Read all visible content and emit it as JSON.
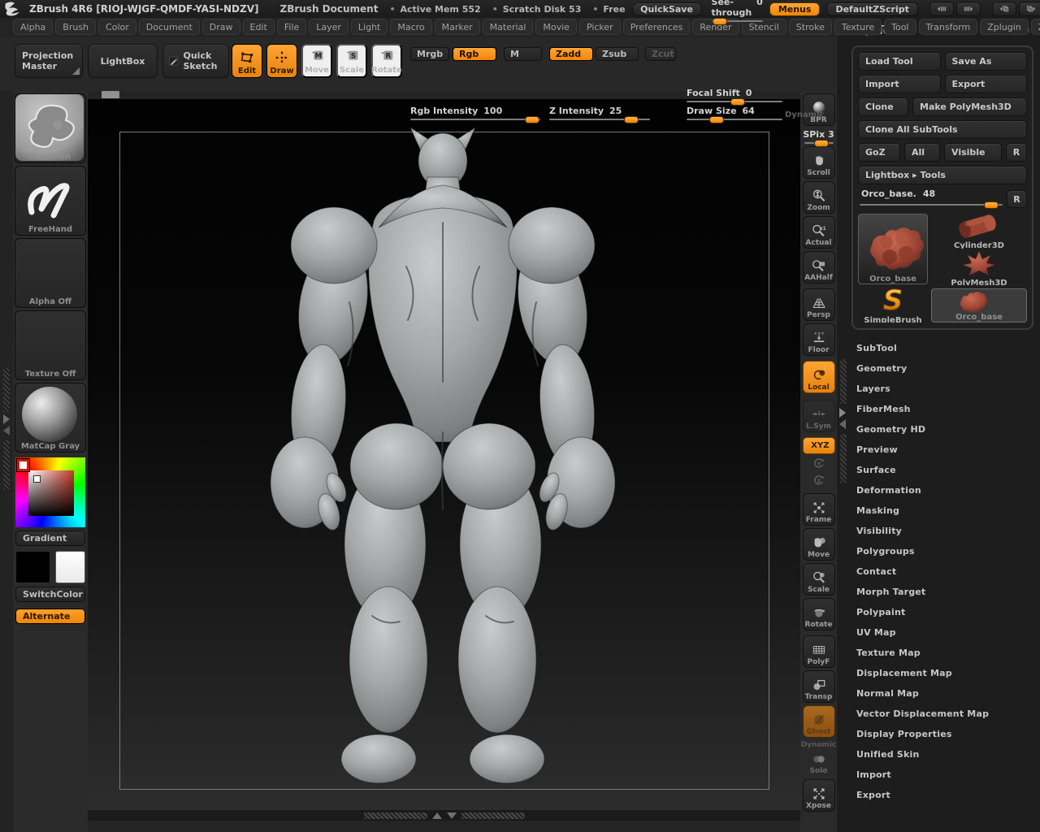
{
  "title_bar": {
    "app_title": "ZBrush 4R6 [RIOJ-WJGF-QMDF-YASI-NDZV]",
    "document_label": "ZBrush Document",
    "stats": [
      "Active Mem 552",
      "Scratch Disk 53",
      "Free"
    ],
    "quicksave": "QuickSave",
    "see_through_label": "See-through",
    "see_through_value": "0",
    "menus": "Menus",
    "default_zscript": "DefaultZScript"
  },
  "menu_bar": {
    "items": [
      "Alpha",
      "Brush",
      "Color",
      "Document",
      "Draw",
      "Edit",
      "File",
      "Layer",
      "Light",
      "Macro",
      "Marker",
      "Material",
      "Movie",
      "Picker",
      "Preferences",
      "Render",
      "Stencil",
      "Stroke",
      "Texture",
      "Tool",
      "Transform",
      "Zplugin",
      "Zscript"
    ]
  },
  "toolbar": {
    "projection_master": "Projection Master",
    "lightbox": "LightBox",
    "quick_sketch": "Quick Sketch",
    "edit": "Edit",
    "draw": "Draw",
    "move": "Move",
    "scale": "Scale",
    "rotate": "Rotate",
    "mrgb": "Mrgb",
    "rgb": "Rgb",
    "m": "M",
    "zadd": "Zadd",
    "zsub": "Zsub",
    "zcut": "Zcut",
    "rgb_intensity_label": "Rgb Intensity",
    "rgb_intensity_value": "100",
    "z_intensity_label": "Z Intensity",
    "z_intensity_value": "25",
    "focal_shift_label": "Focal Shift",
    "focal_shift_value": "0",
    "draw_size_label": "Draw Size",
    "draw_size_value": "64",
    "dynamic": "Dynamic"
  },
  "left_sidebar": {
    "mask_pen": "MaskPen",
    "freehand": "FreeHand",
    "alpha_off": "Alpha  Off",
    "texture_off": "Texture  Off",
    "matcap": "MatCap  Gray",
    "gradient": "Gradient",
    "switch_color": "SwitchColor",
    "alternate": "Alternate"
  },
  "right_shelf": {
    "bpr": "BPR",
    "spix_label": "SPix",
    "spix_value": "3",
    "scroll": "Scroll",
    "zoom": "Zoom",
    "actual": "Actual",
    "aahalf": "AAHalf",
    "persp": "Persp",
    "floor": "Floor",
    "local": "Local",
    "lsym": "L.Sym",
    "xyz": "XYZ",
    "frame": "Frame",
    "move": "Move",
    "scale": "Scale",
    "rotate": "Rotate",
    "polyf": "PolyF",
    "transp": "Transp",
    "ghost": "Ghost",
    "dynamic": "Dynamic",
    "solo": "Solo",
    "xpose": "Xpose"
  },
  "tool_panel": {
    "title": "Tool",
    "load_tool": "Load Tool",
    "save_as": "Save As",
    "import": "Import",
    "export": "Export",
    "clone": "Clone",
    "make_polymesh3d": "Make PolyMesh3D",
    "clone_all_subtools": "Clone All SubTools",
    "goz": "GoZ",
    "all": "All",
    "visible": "Visible",
    "r": "R",
    "lightbox_tools": "Lightbox ▸ Tools",
    "active_tool_label": "Orco_base.",
    "active_tool_value": "48",
    "r2": "R",
    "thumbnails": [
      {
        "name": "Orco_base"
      },
      {
        "name": "Cylinder3D"
      },
      {
        "name": "PolyMesh3D"
      },
      {
        "name": "SimpleBrush"
      },
      {
        "name": "Orco_base"
      }
    ],
    "sections": [
      "SubTool",
      "Geometry",
      "Layers",
      "FiberMesh",
      "Geometry HD",
      "Preview",
      "Surface",
      "Deformation",
      "Masking",
      "Visibility",
      "Polygroups",
      "Contact",
      "Morph Target",
      "Polypaint",
      "UV Map",
      "Texture Map",
      "Displacement Map",
      "Normal Map",
      "Vector Displacement Map",
      "Display Properties",
      "Unified Skin",
      "Import",
      "Export"
    ]
  },
  "colors": {
    "accent": "#ff9100",
    "canvas_bg": "#000000",
    "panel_bg": "#1d1d1d"
  }
}
